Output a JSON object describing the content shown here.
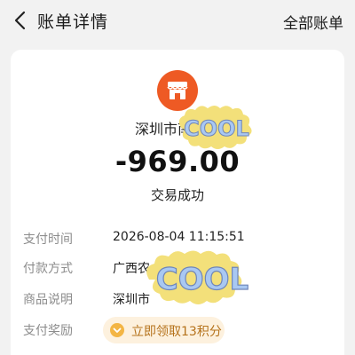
{
  "header": {
    "title": "账单详情",
    "right_link": "全部账单"
  },
  "bill": {
    "merchant": "深圳市南山区",
    "amount": "-969.00",
    "status": "交易成功",
    "rows": [
      {
        "label": "支付时间",
        "value": "2026-08-04 11:15:51"
      },
      {
        "label": "付款方式",
        "value": "广西农"
      },
      {
        "label": "商品说明",
        "value": "深圳市"
      },
      {
        "label": "支付奖励",
        "value": ""
      }
    ],
    "reward_button": "立即领取13积分"
  },
  "stickers": [
    {
      "text": "COOL"
    },
    {
      "text": "COOL"
    }
  ],
  "icons": {
    "back": "chevron-left-icon",
    "merchant": "storefront-icon",
    "reward": "chevron-down-circle-icon"
  },
  "colors": {
    "merchant_icon": "#ee5a24",
    "reward_bg": "#fdf1de",
    "reward_text": "#b5721b",
    "label": "#8c8c8c"
  }
}
